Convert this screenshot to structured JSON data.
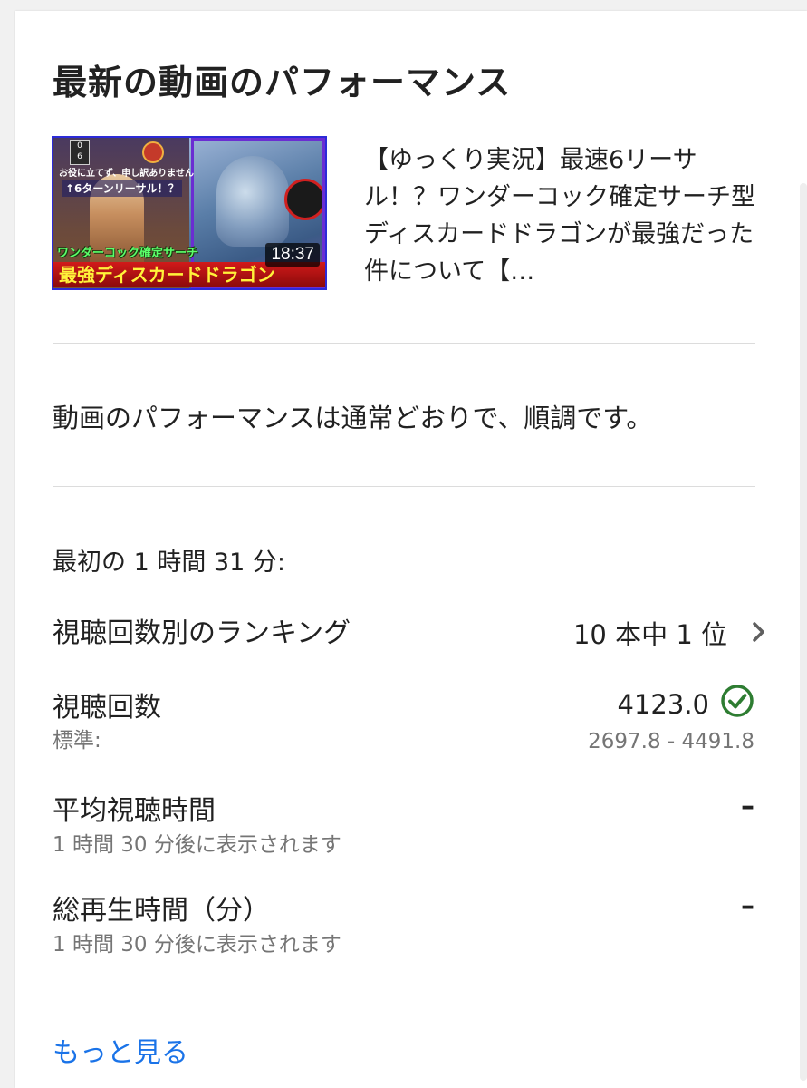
{
  "card": {
    "title": "最新の動画のパフォーマンス"
  },
  "video": {
    "title": "【ゆっくり実況】最速6リーサル！？ワンダーコック確定サーチ型ディスカードドラゴンが最強だった件について【…",
    "duration": "18:37",
    "thumbnail_texts": {
      "top_small": "お役に立てず、申し訳ありません",
      "mid": "↑6ターンリーサル！？",
      "banner_green": "ワンダーコック確定サーチ",
      "banner_red": "最強ディスカードドラゴン",
      "counter_top": "0",
      "counter_bottom": "6"
    }
  },
  "status_message": "動画のパフォーマンスは通常どおりで、順調です。",
  "period_label": "最初の 1 時間 31 分:",
  "metrics": {
    "ranking": {
      "label": "視聴回数別のランキング",
      "value": "10 本中 1 位"
    },
    "views": {
      "label": "視聴回数",
      "sub_label": "標準:",
      "value": "4123.0",
      "range": "2697.8 - 4491.8"
    },
    "avg_view_duration": {
      "label": "平均視聴時間",
      "sub_label": "1 時間 30 分後に表示されます",
      "value": "–"
    },
    "total_watch_time": {
      "label": "総再生時間（分）",
      "sub_label": "1 時間 30 分後に表示されます",
      "value": "–"
    }
  },
  "more_link": "もっと見る",
  "colors": {
    "link": "#1a73e8",
    "check": "#2e7d32",
    "secondary_text": "#757575"
  },
  "icons": {
    "chevron": "chevron-right-icon",
    "check": "check-circle-icon"
  }
}
